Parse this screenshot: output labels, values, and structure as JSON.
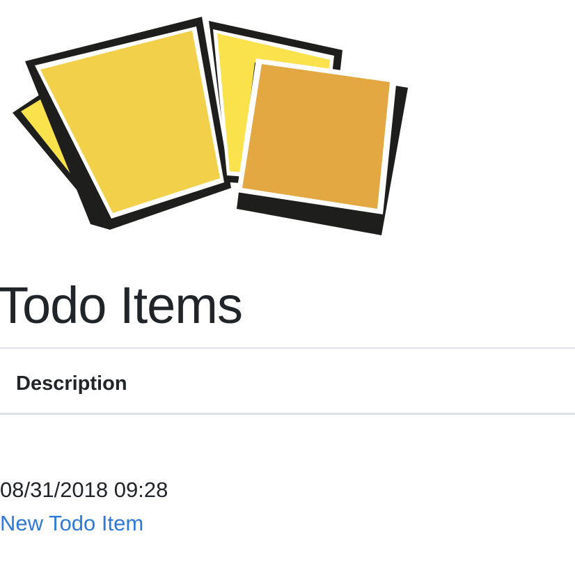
{
  "logo": {
    "icon": "sticky-notes-logo-icon",
    "colors": {
      "note_light": "#f9e24c",
      "note_mid": "#f2d04a",
      "note_orange": "#e3a841",
      "outline": "#1e1f1c"
    }
  },
  "page": {
    "title": "Todo Items"
  },
  "table": {
    "columns": [
      "Description"
    ]
  },
  "item": {
    "timestamp": "08/31/2018 09:28"
  },
  "actions": {
    "new_item_label": "New Todo Item",
    "link_color": "#2f7ad8"
  }
}
